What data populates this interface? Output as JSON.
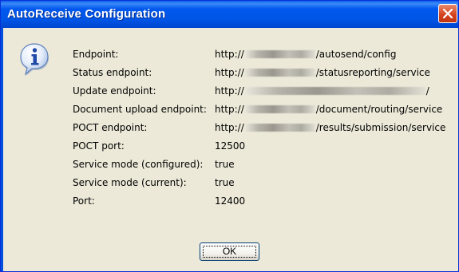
{
  "window": {
    "title": "AutoReceive Configuration"
  },
  "icons": {
    "dialog_icon": "info-icon",
    "close_icon": "close-icon"
  },
  "colors": {
    "titlebar": "#0055e5",
    "dialog_bg": "#ece9d8",
    "close_button": "#d6451f"
  },
  "rows": [
    {
      "label": "Endpoint:",
      "value_prefix": "http://",
      "value_suffix": "/autosend/config"
    },
    {
      "label": "Status endpoint:",
      "value_prefix": "http://",
      "value_suffix": "/statusreporting/service"
    },
    {
      "label": "Update endpoint:",
      "value_prefix": "http://",
      "value_suffix": "/"
    },
    {
      "label": "Document upload endpoint:",
      "value_prefix": "http://",
      "value_suffix": "/document/routing/service"
    },
    {
      "label": "POCT endpoint:",
      "value_prefix": "http://",
      "value_suffix": "/results/submission/service"
    },
    {
      "label": "POCT port:",
      "value": "12500"
    },
    {
      "label": "Service mode (configured):",
      "value": "true"
    },
    {
      "label": "Service mode (current):",
      "value": "true"
    },
    {
      "label": "Port:",
      "value": "12400"
    }
  ],
  "buttons": {
    "ok_label": "OK"
  }
}
